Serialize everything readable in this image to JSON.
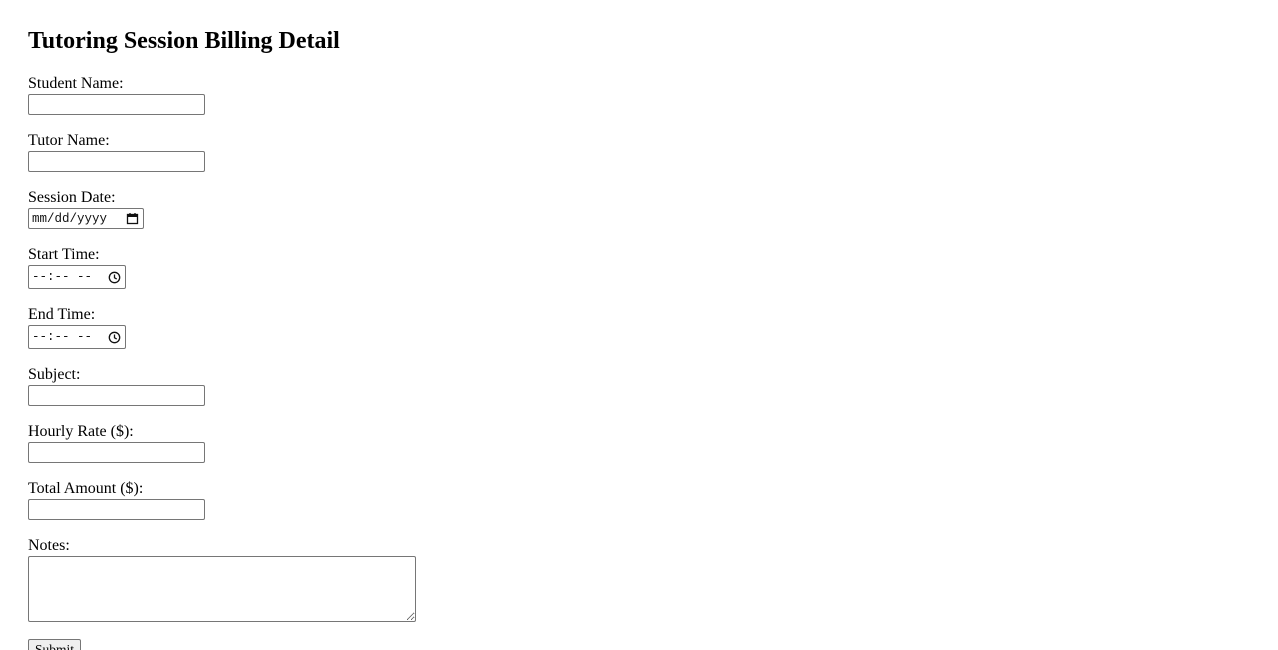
{
  "form": {
    "title": "Tutoring Session Billing Detail",
    "student_name": {
      "label": "Student Name:",
      "value": ""
    },
    "tutor_name": {
      "label": "Tutor Name:",
      "value": ""
    },
    "session_date": {
      "label": "Session Date:",
      "placeholder": "mm/dd/yyyy",
      "icon": "calendar-icon"
    },
    "start_time": {
      "label": "Start Time:",
      "placeholder": "--:-- --",
      "icon": "clock-icon"
    },
    "end_time": {
      "label": "End Time:",
      "placeholder": "--:-- --",
      "icon": "clock-icon"
    },
    "subject": {
      "label": "Subject:",
      "value": ""
    },
    "hourly_rate": {
      "label": "Hourly Rate ($):",
      "value": ""
    },
    "total_amount": {
      "label": "Total Amount ($):",
      "value": ""
    },
    "notes": {
      "label": "Notes:",
      "value": ""
    },
    "submit_label": "Submit"
  }
}
